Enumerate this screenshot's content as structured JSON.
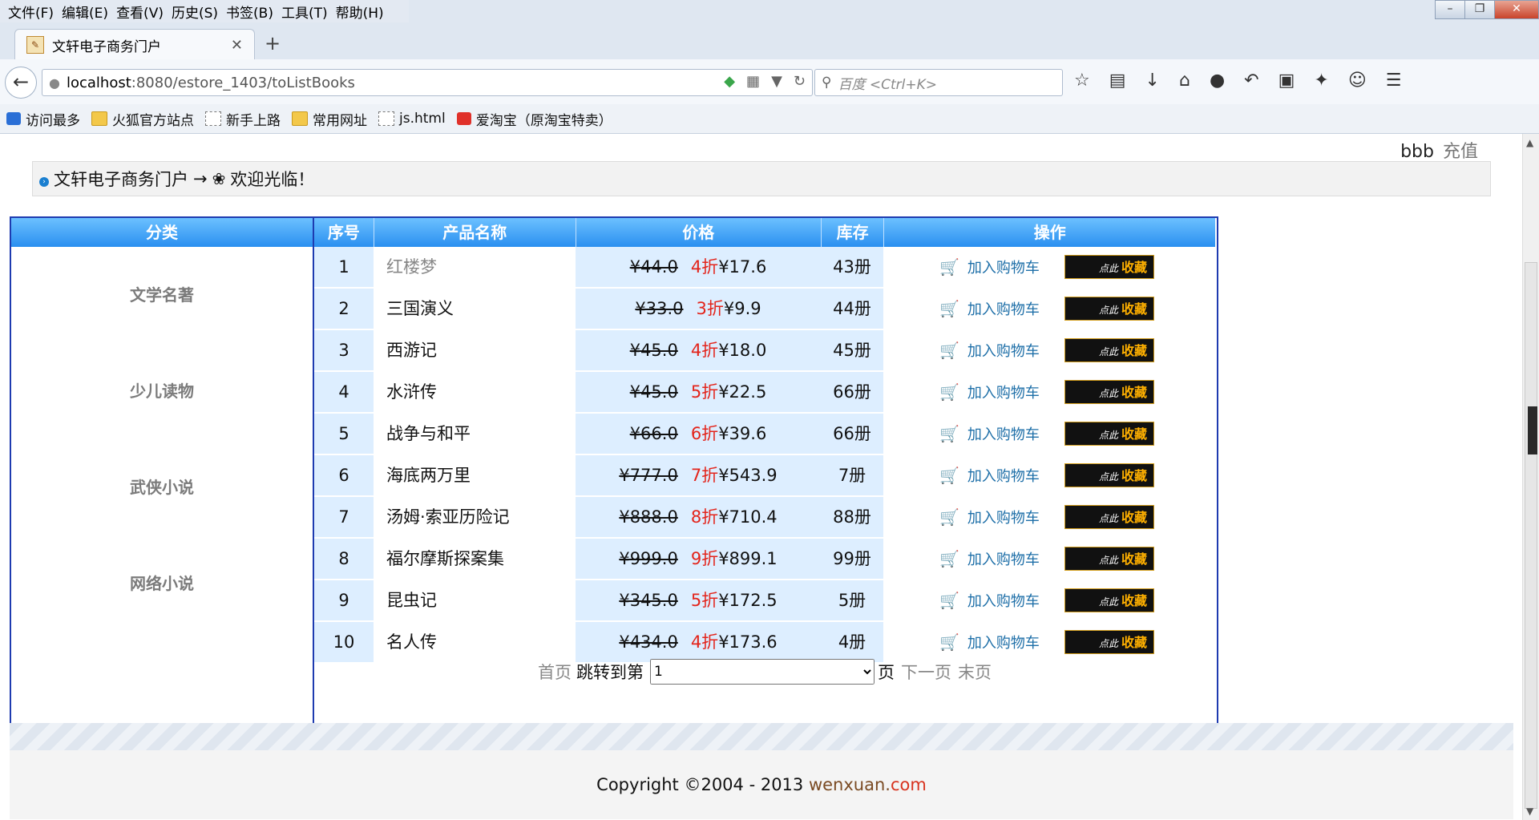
{
  "menu": [
    "文件(F)",
    "编辑(E)",
    "查看(V)",
    "历史(S)",
    "书签(B)",
    "工具(T)",
    "帮助(H)"
  ],
  "tab": {
    "title": "文轩电子商务门户"
  },
  "address": {
    "host": "localhost",
    "path": ":8080/estore_1403/toListBooks"
  },
  "search": {
    "placeholder": "百度 <Ctrl+K>"
  },
  "bookmarks": [
    "访问最多",
    "火狐官方站点",
    "新手上路",
    "常用网址",
    "js.html",
    "爱淘宝（原淘宝特卖）"
  ],
  "user": {
    "name": "bbb",
    "recharge": "充值"
  },
  "crumb": {
    "site": "文轩电子商务门户",
    "arrow": "→",
    "welcome": "欢迎光临！"
  },
  "categories": {
    "header": "分类",
    "items": [
      "文学名著",
      "少儿读物",
      "武侠小说",
      "网络小说"
    ]
  },
  "table": {
    "headers": [
      "序号",
      "产品名称",
      "价格",
      "库存",
      "操作"
    ],
    "rows": [
      {
        "no": "1",
        "name": "红楼梦",
        "old": "¥44.0",
        "disc": "4折",
        "price": "¥17.6",
        "stock": "43册"
      },
      {
        "no": "2",
        "name": "三国演义",
        "old": "¥33.0",
        "disc": "3折",
        "price": "¥9.9",
        "stock": "44册"
      },
      {
        "no": "3",
        "name": "西游记",
        "old": "¥45.0",
        "disc": "4折",
        "price": "¥18.0",
        "stock": "45册"
      },
      {
        "no": "4",
        "name": "水浒传",
        "old": "¥45.0",
        "disc": "5折",
        "price": "¥22.5",
        "stock": "66册"
      },
      {
        "no": "5",
        "name": "战争与和平",
        "old": "¥66.0",
        "disc": "6折",
        "price": "¥39.6",
        "stock": "66册"
      },
      {
        "no": "6",
        "name": "海底两万里",
        "old": "¥777.0",
        "disc": "7折",
        "price": "¥543.9",
        "stock": "7册"
      },
      {
        "no": "7",
        "name": "汤姆·索亚历险记",
        "old": "¥888.0",
        "disc": "8折",
        "price": "¥710.4",
        "stock": "88册"
      },
      {
        "no": "8",
        "name": "福尔摩斯探案集",
        "old": "¥999.0",
        "disc": "9折",
        "price": "¥899.1",
        "stock": "99册"
      },
      {
        "no": "9",
        "name": "昆虫记",
        "old": "¥345.0",
        "disc": "5折",
        "price": "¥172.5",
        "stock": "5册"
      },
      {
        "no": "10",
        "name": "名人传",
        "old": "¥434.0",
        "disc": "4折",
        "price": "¥173.6",
        "stock": "4册"
      }
    ],
    "cart_label": "加入购物车",
    "fav_pre": "点此",
    "fav_label": "收藏"
  },
  "pager": {
    "first": "首页",
    "jump": "跳转到第",
    "selected": "1",
    "page": "页",
    "next": "下一页",
    "last": "末页"
  },
  "footer": {
    "copyright": "Copyright ©2004 - 2013 ",
    "site": "wenxuan.",
    "com": "com"
  }
}
